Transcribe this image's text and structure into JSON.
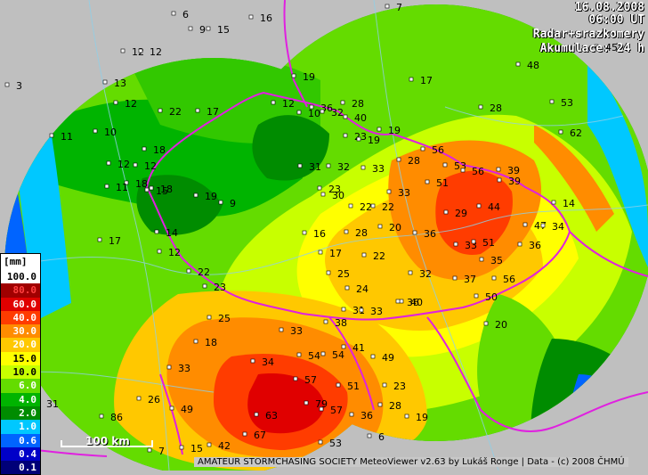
{
  "header": {
    "date": "16.08.2008",
    "time": "06:00 UT",
    "product": "Radar+srazkomery",
    "accumulation": "Akumulace: 24 h"
  },
  "legend": {
    "unit": "[mm]",
    "levels": [
      {
        "label": "100.0",
        "color": "#ffffff",
        "text": "#000000"
      },
      {
        "label": "80.0",
        "color": "#a00000",
        "text": "#ff4040"
      },
      {
        "label": "60.0",
        "color": "#e00000",
        "text": "#ffffff"
      },
      {
        "label": "40.0",
        "color": "#ff3c00",
        "text": "#ffffff"
      },
      {
        "label": "30.0",
        "color": "#ff8c00",
        "text": "#ffffff"
      },
      {
        "label": "20.0",
        "color": "#ffc800",
        "text": "#ffffff"
      },
      {
        "label": "15.0",
        "color": "#ffff00",
        "text": "#000000"
      },
      {
        "label": "10.0",
        "color": "#c8ff00",
        "text": "#000000"
      },
      {
        "label": "6.0",
        "color": "#64dc00",
        "text": "#ffffff"
      },
      {
        "label": "4.0",
        "color": "#00b400",
        "text": "#ffffff"
      },
      {
        "label": "2.0",
        "color": "#008c00",
        "text": "#ffffff"
      },
      {
        "label": "1.0",
        "color": "#00c8ff",
        "text": "#ffffff"
      },
      {
        "label": "0.6",
        "color": "#0064ff",
        "text": "#ffffff"
      },
      {
        "label": "0.4",
        "color": "#0000c8",
        "text": "#ffffff"
      },
      {
        "label": "0.1",
        "color": "#000078",
        "text": "#ffffff"
      }
    ]
  },
  "scale_bar": {
    "label": "100 km"
  },
  "footer": "AMATEUR STORMCHASING SOCIETY MeteoViewer v2.63 by Lukáš Ronge | Data - (c) 2008 ČHMÚ",
  "gauges": [
    {
      "v": "9",
      "c": "#000"
    },
    {
      "v": "15",
      "c": "#000"
    },
    {
      "v": "6",
      "c": "#000"
    },
    {
      "v": "16",
      "c": "#000"
    },
    {
      "v": "7",
      "c": "#000"
    },
    {
      "v": "45",
      "c": "#000"
    },
    {
      "v": "12",
      "c": "#000"
    },
    {
      "v": "12",
      "c": "#000"
    },
    {
      "v": "3",
      "c": "#000"
    },
    {
      "v": "13",
      "c": "#000"
    },
    {
      "v": "19",
      "c": "#000"
    },
    {
      "v": "17",
      "c": "#000"
    },
    {
      "v": "48",
      "c": "#000"
    },
    {
      "v": "12",
      "c": "#000"
    },
    {
      "v": "22",
      "c": "#000"
    },
    {
      "v": "17",
      "c": "#000"
    },
    {
      "v": "28",
      "c": "#000"
    },
    {
      "v": "28",
      "c": "#000"
    },
    {
      "v": "53",
      "c": "#000"
    },
    {
      "v": "11",
      "c": "#000"
    },
    {
      "v": "10",
      "c": "#000"
    },
    {
      "v": "18",
      "c": "#000"
    },
    {
      "v": "12",
      "c": "#000"
    },
    {
      "v": "36",
      "c": "#000"
    },
    {
      "v": "32",
      "c": "#000"
    },
    {
      "v": "40",
      "c": "#000"
    },
    {
      "v": "23",
      "c": "#000"
    },
    {
      "v": "12",
      "c": "#000"
    },
    {
      "v": "10",
      "c": "#000"
    },
    {
      "v": "19",
      "c": "#000"
    },
    {
      "v": "19",
      "c": "#000"
    },
    {
      "v": "62",
      "c": "#000"
    },
    {
      "v": "56",
      "c": "#000"
    },
    {
      "v": "53",
      "c": "#000"
    },
    {
      "v": "18",
      "c": "#000"
    },
    {
      "v": "12",
      "c": "#000"
    },
    {
      "v": "31",
      "c": "#000"
    },
    {
      "v": "32",
      "c": "#000"
    },
    {
      "v": "33",
      "c": "#000"
    },
    {
      "v": "56",
      "c": "#000"
    },
    {
      "v": "39",
      "c": "#000"
    },
    {
      "v": "28",
      "c": "#000"
    },
    {
      "v": "18",
      "c": "#000"
    },
    {
      "v": "15",
      "c": "#000"
    },
    {
      "v": "9",
      "c": "#000"
    },
    {
      "v": "19",
      "c": "#000"
    },
    {
      "v": "11",
      "c": "#000"
    },
    {
      "v": "30",
      "c": "#000"
    },
    {
      "v": "23",
      "c": "#000"
    },
    {
      "v": "22",
      "c": "#000"
    },
    {
      "v": "33",
      "c": "#000"
    },
    {
      "v": "51",
      "c": "#000"
    },
    {
      "v": "39",
      "c": "#000"
    },
    {
      "v": "14",
      "c": "#000"
    },
    {
      "v": "14",
      "c": "#000"
    },
    {
      "v": "22",
      "c": "#000"
    },
    {
      "v": "29",
      "c": "#000"
    },
    {
      "v": "44",
      "c": "#000"
    },
    {
      "v": "47",
      "c": "#000"
    },
    {
      "v": "34",
      "c": "#000"
    },
    {
      "v": "17",
      "c": "#000"
    },
    {
      "v": "16",
      "c": "#000"
    },
    {
      "v": "28",
      "c": "#000"
    },
    {
      "v": "20",
      "c": "#000"
    },
    {
      "v": "36",
      "c": "#000"
    },
    {
      "v": "33",
      "c": "#000"
    },
    {
      "v": "51",
      "c": "#000"
    },
    {
      "v": "36",
      "c": "#000"
    },
    {
      "v": "12",
      "c": "#000"
    },
    {
      "v": "17",
      "c": "#000"
    },
    {
      "v": "22",
      "c": "#000"
    },
    {
      "v": "32",
      "c": "#000"
    },
    {
      "v": "35",
      "c": "#000"
    },
    {
      "v": "22",
      "c": "#000"
    },
    {
      "v": "25",
      "c": "#000"
    },
    {
      "v": "37",
      "c": "#000"
    },
    {
      "v": "56",
      "c": "#000"
    },
    {
      "v": "23",
      "c": "#000"
    },
    {
      "v": "24",
      "c": "#000"
    },
    {
      "v": "50",
      "c": "#000"
    },
    {
      "v": "40",
      "c": "#000"
    },
    {
      "v": "25",
      "c": "#000"
    },
    {
      "v": "31",
      "c": "#000"
    },
    {
      "v": "33",
      "c": "#000"
    },
    {
      "v": "36",
      "c": "#000"
    },
    {
      "v": "54",
      "c": "#000"
    },
    {
      "v": "20",
      "c": "#000"
    },
    {
      "v": "18",
      "c": "#000"
    },
    {
      "v": "33",
      "c": "#000"
    },
    {
      "v": "38",
      "c": "#000"
    },
    {
      "v": "33",
      "c": "#000"
    },
    {
      "v": "34",
      "c": "#000"
    },
    {
      "v": "41",
      "c": "#000"
    },
    {
      "v": "54",
      "c": "#000"
    },
    {
      "v": "49",
      "c": "#000"
    },
    {
      "v": "51",
      "c": "#000"
    },
    {
      "v": "57",
      "c": "#000"
    },
    {
      "v": "63",
      "c": "#000"
    },
    {
      "v": "79",
      "c": "#000"
    },
    {
      "v": "57",
      "c": "#000"
    },
    {
      "v": "67",
      "c": "#000"
    },
    {
      "v": "53",
      "c": "#000"
    },
    {
      "v": "36",
      "c": "#000"
    },
    {
      "v": "28",
      "c": "#000"
    },
    {
      "v": "23",
      "c": "#000"
    },
    {
      "v": "19",
      "c": "#000"
    },
    {
      "v": "6",
      "c": "#000"
    },
    {
      "v": "15",
      "c": "#000"
    },
    {
      "v": "42",
      "c": "#000"
    },
    {
      "v": "49",
      "c": "#000"
    },
    {
      "v": "26",
      "c": "#000"
    },
    {
      "v": "31",
      "c": "#000"
    },
    {
      "v": "86",
      "c": "#000"
    },
    {
      "v": "7",
      "c": "#000"
    }
  ]
}
